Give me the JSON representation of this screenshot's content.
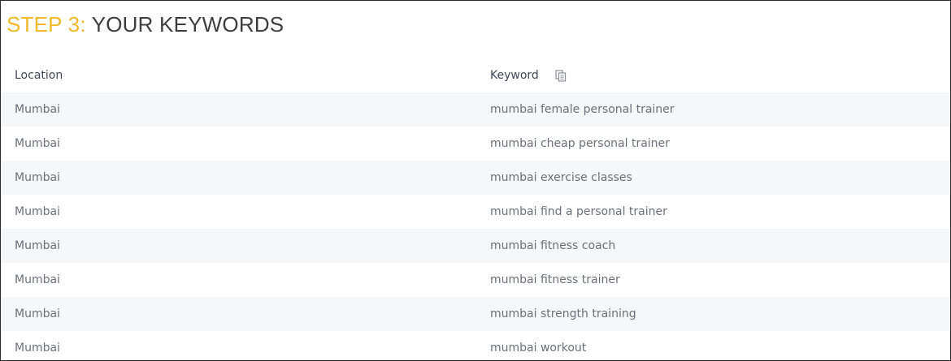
{
  "title": {
    "step": "STEP 3",
    "separator": ":",
    "text": " YOUR KEYWORDS"
  },
  "table": {
    "columns": {
      "location": "Location",
      "keyword": "Keyword"
    },
    "copy_icon": "copy-icon",
    "rows": [
      {
        "location": "Mumbai",
        "keyword": "mumbai female personal trainer"
      },
      {
        "location": "Mumbai",
        "keyword": "mumbai cheap personal trainer"
      },
      {
        "location": "Mumbai",
        "keyword": "mumbai exercise classes"
      },
      {
        "location": "Mumbai",
        "keyword": "mumbai find a personal trainer"
      },
      {
        "location": "Mumbai",
        "keyword": "mumbai fitness coach"
      },
      {
        "location": "Mumbai",
        "keyword": "mumbai fitness trainer"
      },
      {
        "location": "Mumbai",
        "keyword": "mumbai strength training"
      },
      {
        "location": "Mumbai",
        "keyword": "mumbai workout"
      }
    ]
  },
  "colors": {
    "accent": "#f3b82a",
    "heading_text": "#3d3d3d",
    "row_stripe": "#f6f7f9",
    "cell_text": "#6b6f78"
  }
}
